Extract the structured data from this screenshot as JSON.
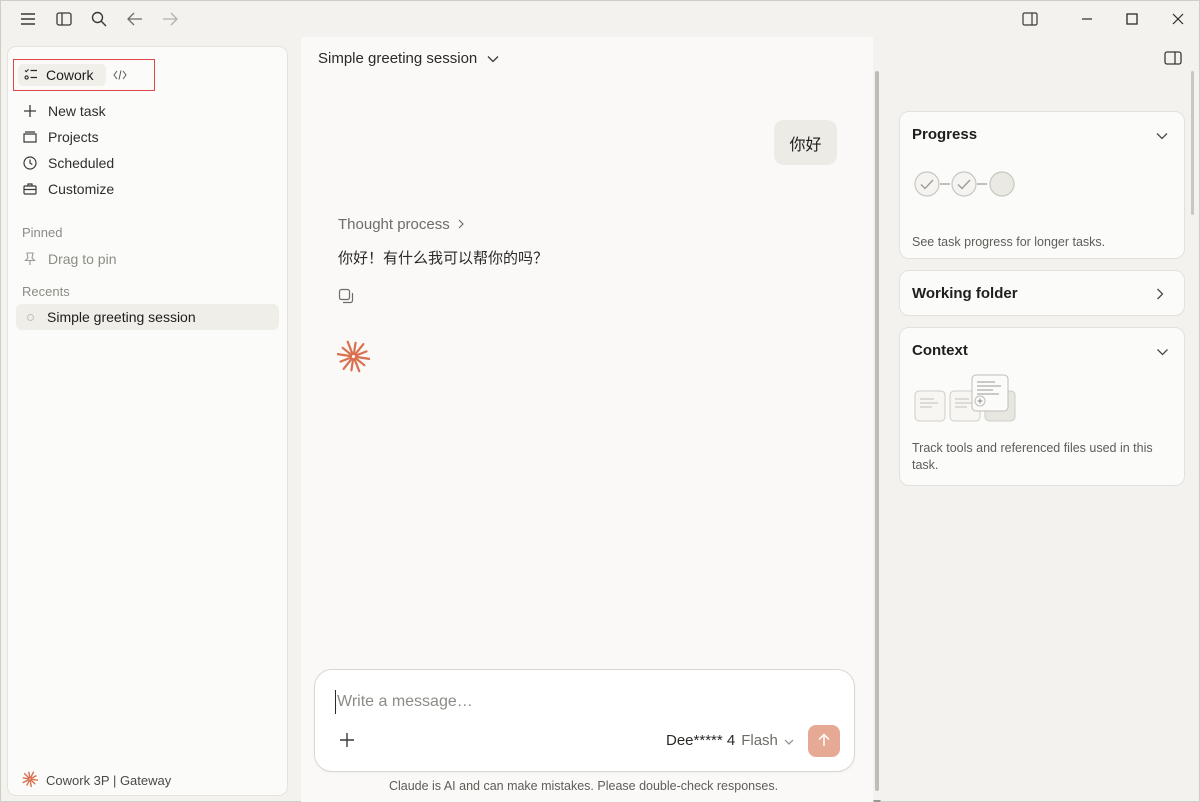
{
  "sidebar": {
    "mode_cowork": "Cowork",
    "nav": [
      {
        "label": "New task",
        "icon": "plus-icon"
      },
      {
        "label": "Projects",
        "icon": "folder-icon"
      },
      {
        "label": "Scheduled",
        "icon": "clock-icon"
      },
      {
        "label": "Customize",
        "icon": "briefcase-icon"
      }
    ],
    "pinned_label": "Pinned",
    "pin_hint": "Drag to pin",
    "recents_label": "Recents",
    "recents": [
      {
        "label": "Simple greeting session"
      }
    ],
    "footer": "Cowork 3P | Gateway"
  },
  "main": {
    "session_title": "Simple greeting session",
    "user_message": "你好",
    "thought_label": "Thought process",
    "assistant_message": "你好！有什么我可以帮你的吗？"
  },
  "composer": {
    "placeholder": "Write a message…",
    "model_name": "Dee***** 4",
    "model_variant": "Flash",
    "disclaimer": "Claude is AI and can make mistakes. Please double-check responses."
  },
  "right_panel": {
    "progress_title": "Progress",
    "progress_desc": "See task progress for longer tasks.",
    "working_folder_title": "Working folder",
    "context_title": "Context",
    "context_desc": "Track tools and referenced files used in this task."
  },
  "colors": {
    "accent": "#d9704f",
    "send_button": "#e6a993",
    "highlight_box": "#e0464b",
    "background": "#f3f2ee"
  }
}
